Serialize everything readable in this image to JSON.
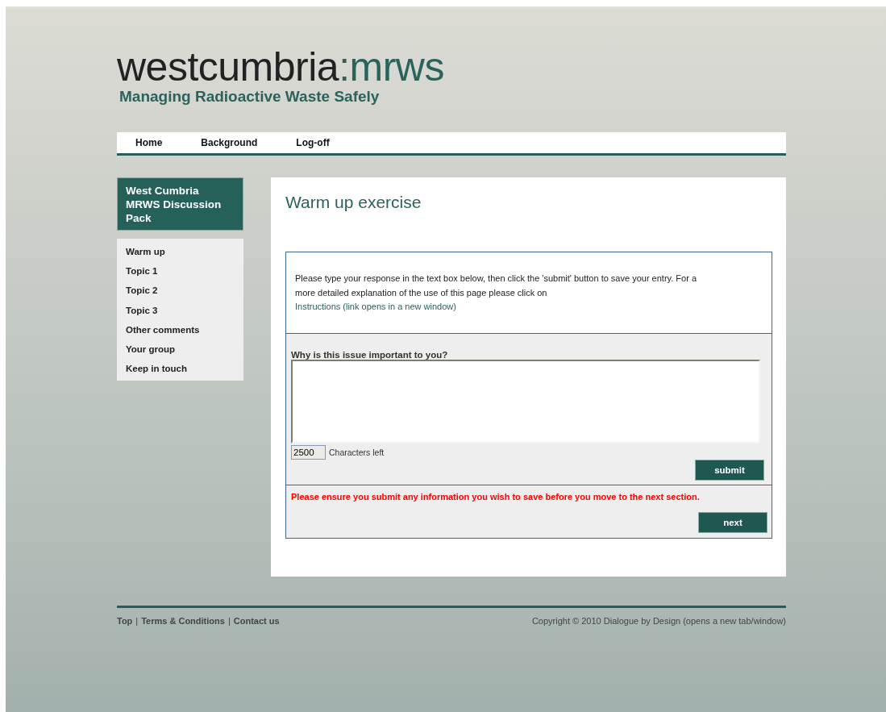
{
  "logo": {
    "main": "westcumbria",
    "colon": ":",
    "accent": "mrws",
    "tagline": "Managing Radioactive Waste Safely"
  },
  "nav": [
    "Home",
    "Background",
    "Log-off"
  ],
  "sidebar": {
    "title": "West Cumbria MRWS Discussion Pack",
    "items": [
      "Warm up",
      "Topic 1",
      "Topic 2",
      "Topic 3",
      "Other comments",
      "Your group",
      "Keep in touch"
    ]
  },
  "main": {
    "heading": "Warm up exercise",
    "intro": "Please type your response in the text box below, then click the 'submit' button to save your entry. For a more detailed explanation of the use of this page please click on ",
    "intro_link": "Instructions (link opens in a new window)",
    "question": "Why is this issue important to you?",
    "counter": "2500",
    "counter_label": "Characters left",
    "submit": "submit",
    "warning": "Please ensure you submit any information you wish to save before you move to the next section.",
    "next": "next"
  },
  "footer": {
    "links": [
      "Top",
      "Terms & Conditions",
      "Contact us"
    ],
    "separator": "|",
    "copyright": "Copyright © 2010 Dialogue by Design (opens a new tab/window)"
  }
}
